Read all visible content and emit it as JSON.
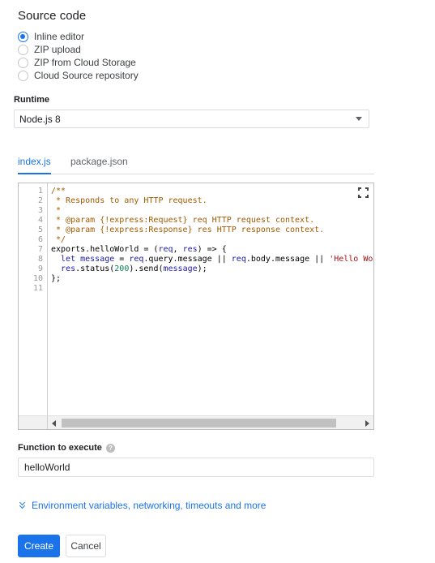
{
  "source_code": {
    "title": "Source code",
    "options": [
      {
        "label": "Inline editor",
        "checked": true
      },
      {
        "label": "ZIP upload",
        "checked": false
      },
      {
        "label": "ZIP from Cloud Storage",
        "checked": false
      },
      {
        "label": "Cloud Source repository",
        "checked": false
      }
    ]
  },
  "runtime": {
    "label": "Runtime",
    "selected": "Node.js 8"
  },
  "tabs": [
    {
      "label": "index.js",
      "active": true
    },
    {
      "label": "package.json",
      "active": false
    }
  ],
  "editor": {
    "line_numbers": [
      "1",
      "2",
      "3",
      "4",
      "5",
      "6",
      "7",
      "8",
      "9",
      "10",
      "11"
    ],
    "lines": [
      [
        {
          "t": "/**",
          "c": "comment"
        }
      ],
      [
        {
          "t": " * Responds to any HTTP request.",
          "c": "comment"
        }
      ],
      [
        {
          "t": " *",
          "c": "comment"
        }
      ],
      [
        {
          "t": " * @param {!express:Request} req HTTP request context.",
          "c": "comment"
        }
      ],
      [
        {
          "t": " * @param {!express:Response} res HTTP response context.",
          "c": "comment"
        }
      ],
      [
        {
          "t": " */",
          "c": "comment"
        }
      ],
      [
        {
          "t": "exports.helloWorld = (",
          "c": "plain"
        },
        {
          "t": "req",
          "c": "var"
        },
        {
          "t": ", ",
          "c": "plain"
        },
        {
          "t": "res",
          "c": "var"
        },
        {
          "t": ") => {",
          "c": "plain"
        }
      ],
      [
        {
          "t": "  let ",
          "c": "var"
        },
        {
          "t": "message",
          "c": "var"
        },
        {
          "t": " = ",
          "c": "plain"
        },
        {
          "t": "req",
          "c": "var"
        },
        {
          "t": ".query.message || ",
          "c": "plain"
        },
        {
          "t": "req",
          "c": "var"
        },
        {
          "t": ".body.message || ",
          "c": "plain"
        },
        {
          "t": "'Hello Wor",
          "c": "str"
        }
      ],
      [
        {
          "t": "  ",
          "c": "plain"
        },
        {
          "t": "res",
          "c": "var"
        },
        {
          "t": ".status(",
          "c": "plain"
        },
        {
          "t": "200",
          "c": "num"
        },
        {
          "t": ").send(",
          "c": "plain"
        },
        {
          "t": "message",
          "c": "var"
        },
        {
          "t": ");",
          "c": "plain"
        }
      ],
      [
        {
          "t": "};",
          "c": "plain"
        }
      ],
      [
        {
          "t": "",
          "c": "plain"
        }
      ]
    ],
    "fullscreen_icon": "fullscreen-icon"
  },
  "function_to_execute": {
    "label": "Function to execute",
    "help_glyph": "?",
    "value": "helloWorld"
  },
  "more_link": "Environment variables, networking, timeouts and more",
  "buttons": {
    "create": "Create",
    "cancel": "Cancel"
  },
  "colors": {
    "accent": "#1a73e8"
  }
}
